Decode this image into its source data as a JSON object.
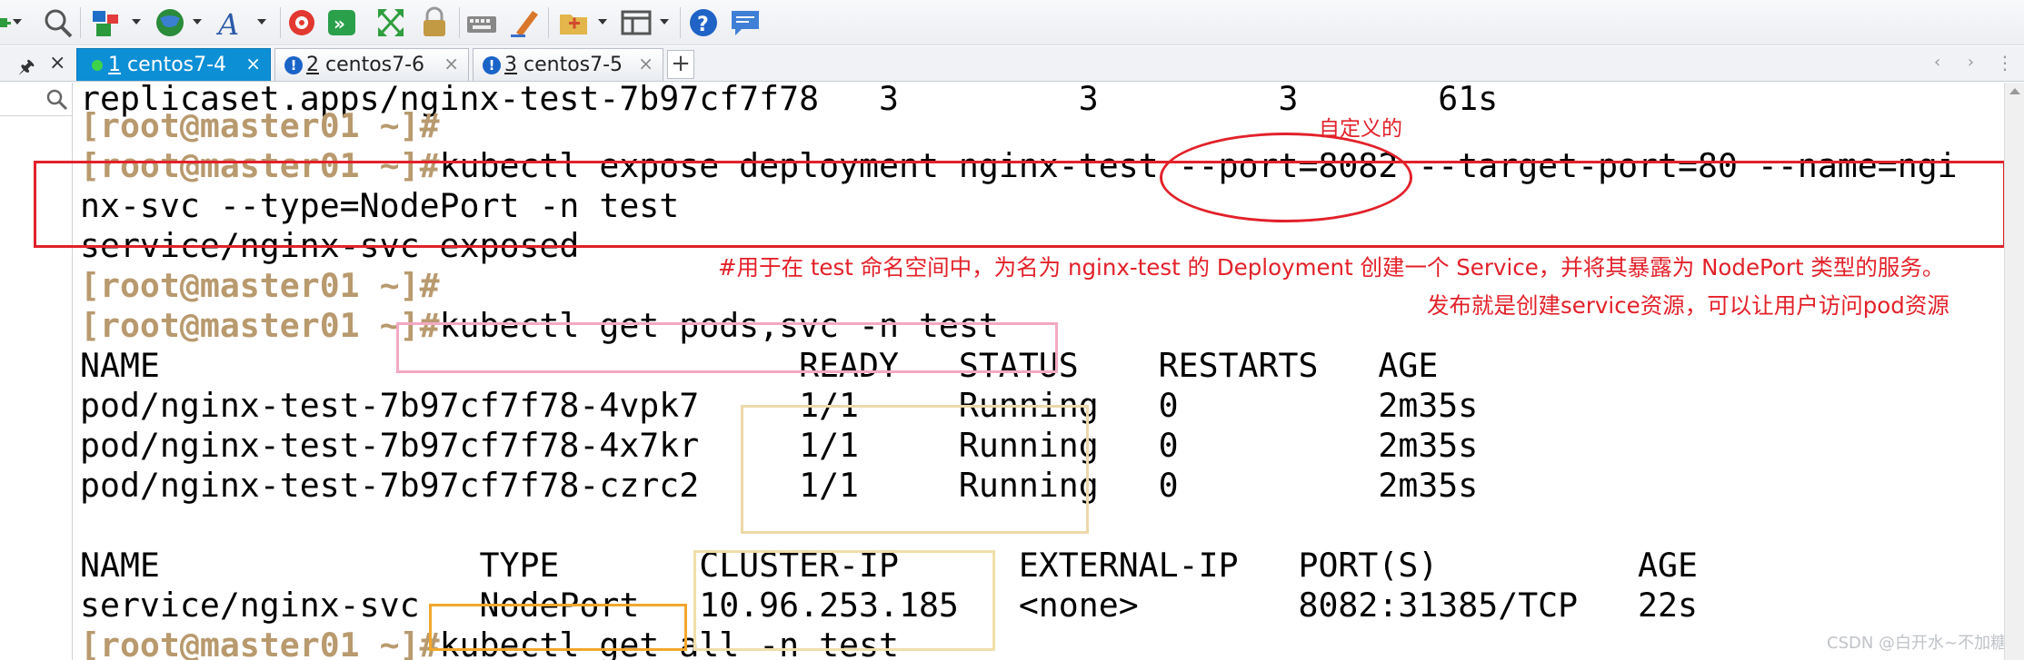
{
  "toolbar": {
    "icons": [
      "new-session-icon",
      "find-icon",
      "session-manager-icon",
      "globe-icon",
      "font-icon",
      "xftp-icon",
      "xshell-icon",
      "fullscreen-icon",
      "lock-icon",
      "keyboard-icon",
      "highlight-icon",
      "folder-icon",
      "layout-icon",
      "help-icon",
      "chat-icon"
    ]
  },
  "tabs": [
    {
      "number": "1",
      "name": " centos7-4",
      "status": "connected",
      "active": true
    },
    {
      "number": "2",
      "name": " centos7-6",
      "status": "warning",
      "active": false
    },
    {
      "number": "3",
      "name": " centos7-5",
      "status": "warning",
      "active": false
    }
  ],
  "tab_controls": {
    "add": "+",
    "scroll": "‹ ›",
    "menu": "⋮",
    "close": "×",
    "pin": "🖈"
  },
  "terminal": {
    "prompt": "[root@master01 ~]#",
    "lines": {
      "l1": "replicaset.apps/nginx-test-7b97cf7f78   3         3         3       61s",
      "l3_cmd": "kubectl expose deployment nginx-test --port=8082 --target-port=80 --name=ngi",
      "l4": "nx-svc --type=NodePort -n test",
      "l5": "service/nginx-svc exposed",
      "l7_cmd": "kubectl get pods,svc -n test",
      "l8": "NAME                                READY   STATUS    RESTARTS   AGE",
      "l9": "pod/nginx-test-7b97cf7f78-4vpk7     1/1     Running   0          2m35s",
      "l10": "pod/nginx-test-7b97cf7f78-4x7kr     1/1     Running   0          2m35s",
      "l11": "pod/nginx-test-7b97cf7f78-czrc2     1/1     Running   0          2m35s",
      "l13": "NAME                TYPE       CLUSTER-IP      EXTERNAL-IP   PORT(S)          AGE",
      "l14": "service/nginx-svc   NodePort   10.96.253.185   <none>        8082:31385/TCP   22s",
      "l15_cmd": "kubectl get all -n test"
    }
  },
  "annotations": {
    "custom_label": "自定义的",
    "desc1": "#用于在 test 命名空间中，为名为 nginx-test 的 Deployment 创建一个 Service，并将其暴露为 NodePort 类型的服务。",
    "desc2": "发布就是创建service资源，可以让用户访问pod资源"
  },
  "watermark": "CSDN @白开水~不加糖",
  "colors": {
    "prompt": "#b89a6e",
    "annotation_red": "#e2212a",
    "active_tab": "#0d8fd6",
    "pink_box": "#f3a9c4",
    "yellow_box": "#ecd8a9",
    "orange_box": "#f2a72a"
  }
}
